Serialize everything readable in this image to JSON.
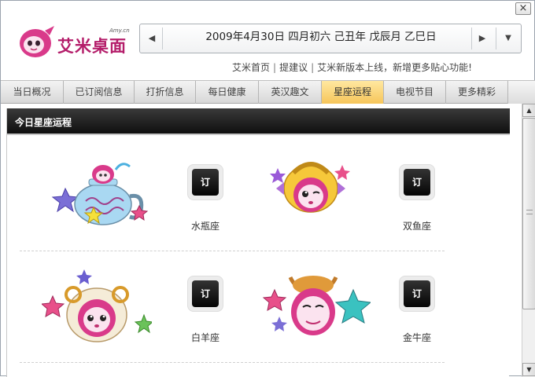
{
  "window": {
    "close_label": "×"
  },
  "logo": {
    "text": "艾米桌面",
    "domain": "Amy.cn"
  },
  "datebar": {
    "prev_icon": "◀",
    "date_text": "2009年4月30日 四月初六 己丑年 戊辰月 乙巳日",
    "next_icon": "▶",
    "dropdown_icon": "▼"
  },
  "toplinks": {
    "home": "艾米首页",
    "suggest": "提建议",
    "news": "艾米新版本上线，新增更多贴心功能!"
  },
  "tabs": [
    {
      "label": "当日概况"
    },
    {
      "label": "已订阅信息"
    },
    {
      "label": "打折信息"
    },
    {
      "label": "每日健康"
    },
    {
      "label": "英汉趣文"
    },
    {
      "label": "星座运程"
    },
    {
      "label": "电视节目"
    },
    {
      "label": "更多精彩"
    }
  ],
  "active_tab": "星座运程",
  "panel": {
    "title": "今日星座运程"
  },
  "signs": [
    {
      "name": "水瓶座",
      "button": "订"
    },
    {
      "name": "双鱼座",
      "button": "订"
    },
    {
      "name": "白羊座",
      "button": "订"
    },
    {
      "name": "金牛座",
      "button": "订"
    }
  ],
  "colors": {
    "accent": "#b41d6a",
    "active_tab": "#f6c55a",
    "header_bg": "#111111"
  }
}
